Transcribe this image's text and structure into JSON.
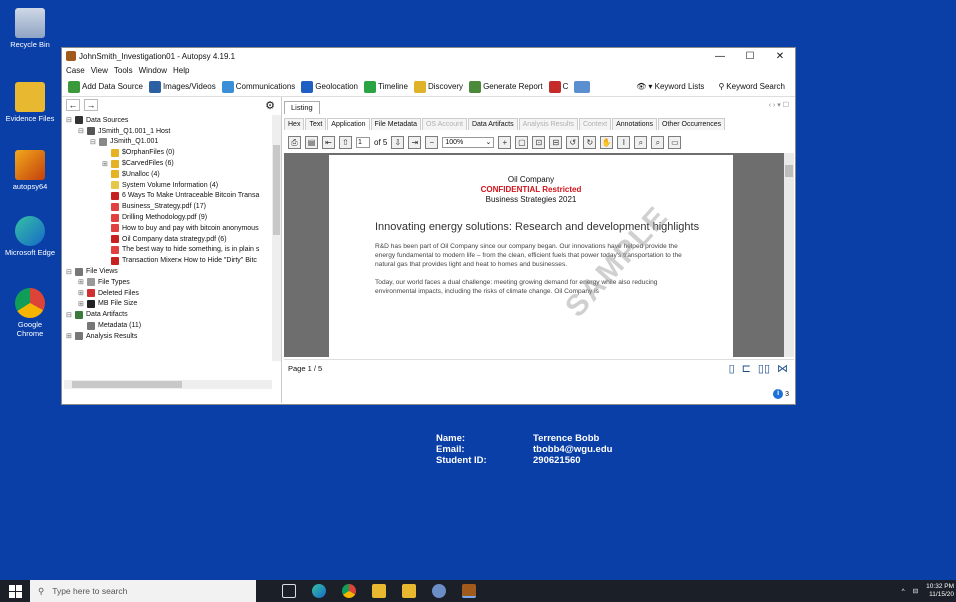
{
  "desktop": {
    "icons": [
      {
        "label": "Recycle Bin"
      },
      {
        "label": "Evidence Files"
      },
      {
        "label": "autopsy64"
      },
      {
        "label": "Microsoft Edge"
      },
      {
        "label": "Google Chrome"
      }
    ]
  },
  "window": {
    "title": "JohnSmith_Investigation01 - Autopsy 4.19.1",
    "controls": {
      "minimize": "—",
      "maximize": "☐",
      "close": "✕"
    },
    "menu": [
      "Case",
      "View",
      "Tools",
      "Window",
      "Help"
    ],
    "toolbar": {
      "items": [
        {
          "label": "Add Data Source",
          "color": "#3a9a3a"
        },
        {
          "label": "Images/Videos",
          "color": "#2d5fa3"
        },
        {
          "label": "Communications",
          "color": "#3b8fd6"
        },
        {
          "label": "Geolocation",
          "color": "#1f5fc4"
        },
        {
          "label": "Timeline",
          "color": "#2aa342"
        },
        {
          "label": "Discovery",
          "color": "#e0b228"
        },
        {
          "label": "Generate Report",
          "color": "#4a8a3a"
        },
        {
          "label": "C",
          "color": "#c62b2b"
        }
      ],
      "keyword_lists": "▾ Keyword Lists",
      "keyword_search": "Keyword Search"
    }
  },
  "tree": {
    "rows": [
      {
        "label": "Data Sources",
        "indent": 0,
        "exp": "⊟",
        "color": "#333"
      },
      {
        "label": "JSmith_Q1.001_1 Host",
        "indent": 1,
        "exp": "⊟",
        "color": "#555"
      },
      {
        "label": "JSmith_Q1.001",
        "indent": 2,
        "exp": "⊟",
        "color": "#888"
      },
      {
        "label": "$OrphanFiles (0)",
        "indent": 3,
        "exp": "",
        "color": "#e5b224"
      },
      {
        "label": "$CarvedFiles (6)",
        "indent": 3,
        "exp": "⊞",
        "color": "#e5b224"
      },
      {
        "label": "$Unalloc (4)",
        "indent": 3,
        "exp": "",
        "color": "#e5b224"
      },
      {
        "label": "System Volume Information (4)",
        "indent": 3,
        "exp": "",
        "color": "#e5c84a"
      },
      {
        "label": "6 Ways To Make Untraceable Bitcoin Transa",
        "indent": 3,
        "exp": "",
        "color": "#c62020"
      },
      {
        "label": "Business_Strategy.pdf (17)",
        "indent": 3,
        "exp": "",
        "color": "#e04040"
      },
      {
        "label": "Drilling Methodology.pdf (9)",
        "indent": 3,
        "exp": "",
        "color": "#e04040"
      },
      {
        "label": "How to buy and pay with bitcoin anonymous",
        "indent": 3,
        "exp": "",
        "color": "#e04040"
      },
      {
        "label": "Oil Company data strategy.pdf (6)",
        "indent": 3,
        "exp": "",
        "color": "#c62020"
      },
      {
        "label": "The best way to hide something, is in plain s",
        "indent": 3,
        "exp": "",
        "color": "#e04040"
      },
      {
        "label": "Transaction Mixer⪤ How to Hide \"Dirty\" Bitc",
        "indent": 3,
        "exp": "",
        "color": "#c62020"
      },
      {
        "label": "File Views",
        "indent": 0,
        "exp": "⊟",
        "color": "#777"
      },
      {
        "label": "File Types",
        "indent": 1,
        "exp": "⊞",
        "color": "#999"
      },
      {
        "label": "Deleted Files",
        "indent": 1,
        "exp": "⊞",
        "color": "#d03030"
      },
      {
        "label": "MB File Size",
        "indent": 1,
        "exp": "⊞",
        "color": "#222"
      },
      {
        "label": "Data Artifacts",
        "indent": 0,
        "exp": "⊟",
        "color": "#3a7a3a"
      },
      {
        "label": "Metadata (11)",
        "indent": 1,
        "exp": "",
        "color": "#777"
      },
      {
        "label": "Analysis Results",
        "indent": 0,
        "exp": "⊞",
        "color": "#777"
      }
    ]
  },
  "listing": {
    "tab": "Listing",
    "controls": "‹ › ▾ ☐",
    "tabs": [
      {
        "label": "Hex",
        "state": ""
      },
      {
        "label": "Text",
        "state": ""
      },
      {
        "label": "Application",
        "state": "active"
      },
      {
        "label": "File Metadata",
        "state": ""
      },
      {
        "label": "OS Account",
        "state": "dim"
      },
      {
        "label": "Data Artifacts",
        "state": ""
      },
      {
        "label": "Analysis Results",
        "state": "dim"
      },
      {
        "label": "Context",
        "state": "dim"
      },
      {
        "label": "Annotations",
        "state": ""
      },
      {
        "label": "Other Occurrences",
        "state": ""
      }
    ],
    "viewer": {
      "page_input": "1",
      "page_of": "of 5",
      "zoom": "100%"
    },
    "pdf": {
      "company": "Oil Company",
      "confidential": "CONFIDENTIAL Restricted",
      "subtitle": "Business Strategies 2021",
      "heading": "Innovating energy solutions: Research and development highlights",
      "para1": "R&D has been part of Oil Company since our company began. Our innovations have helped provide the energy fundamental to modern life – from the clean, efficient fuels that power today's transportation to the natural gas that provides light and heat to homes and businesses.",
      "para2": "Today, our world faces a dual challenge: meeting growing demand for energy while also reducing environmental impacts, including the risks of climate change. Oil Company is",
      "watermark": "SAMPLE"
    },
    "page_label": "Page 1 / 5",
    "status_count": "3"
  },
  "info": {
    "name_label": "Name:",
    "name_value": "Terrence Bobb",
    "email_label": "Email:",
    "email_value": "tbobb4@wgu.edu",
    "id_label": "Student ID:",
    "id_value": "290621560"
  },
  "taskbar": {
    "search_placeholder": "Type here to search",
    "time": "10:32 PM",
    "date": "11/15/20"
  }
}
